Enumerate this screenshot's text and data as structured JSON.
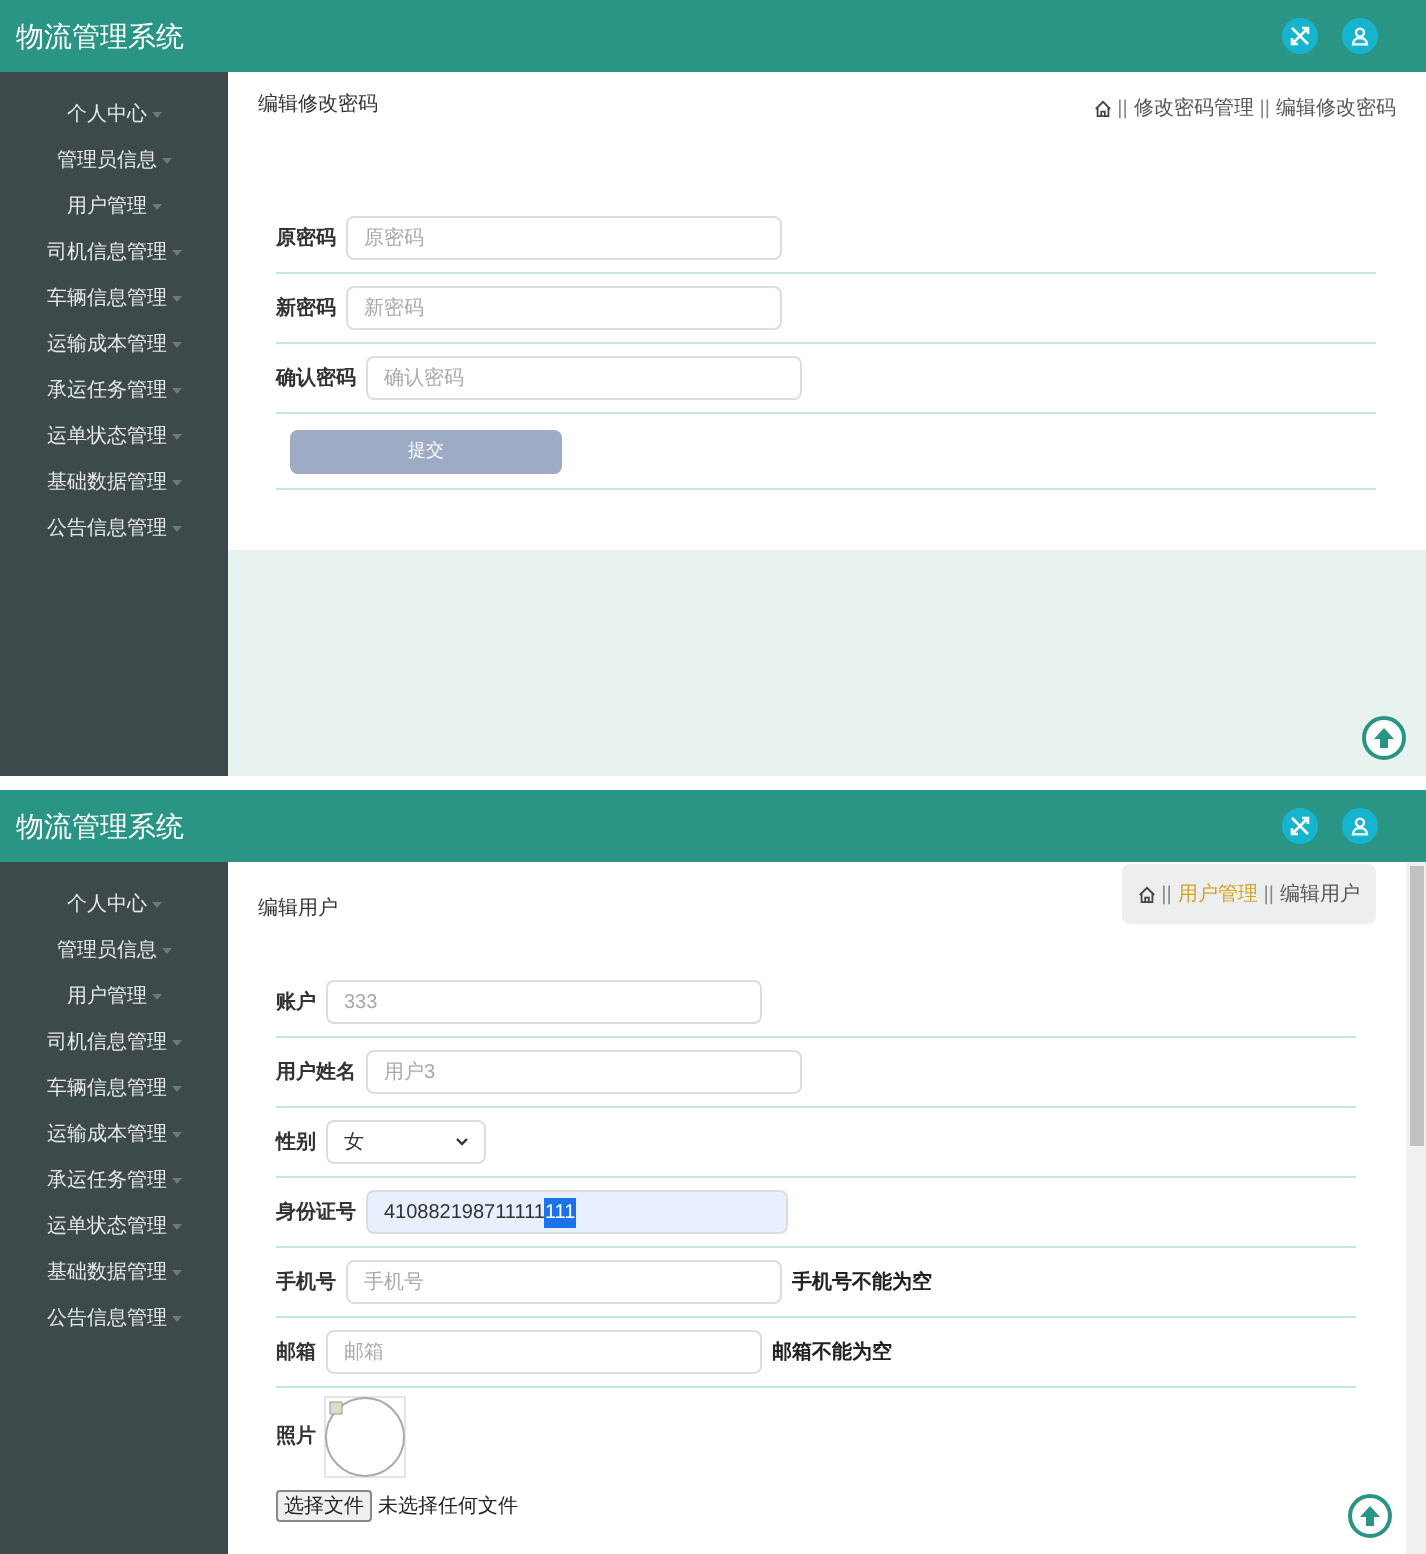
{
  "screens": [
    {
      "kind": "password",
      "header": {
        "title": "物流管理系统"
      },
      "sidebar": {
        "items": [
          "个人中心",
          "管理员信息",
          "用户管理",
          "司机信息管理",
          "车辆信息管理",
          "运输成本管理",
          "承运任务管理",
          "运单状态管理",
          "基础数据管理",
          "公告信息管理"
        ]
      },
      "page_title": "编辑修改密码",
      "breadcrumb": {
        "boxed": false,
        "separator": "||",
        "items": [
          {
            "label": "修改密码管理",
            "link": false
          },
          {
            "label": "编辑修改密码",
            "link": false
          }
        ]
      },
      "rows": [
        {
          "kind": "input",
          "label": "原密码",
          "placeholder": "原密码"
        },
        {
          "kind": "input",
          "label": "新密码",
          "placeholder": "新密码"
        },
        {
          "kind": "input",
          "label": "确认密码",
          "placeholder": "确认密码"
        }
      ],
      "submit": "提交",
      "scrollbar": false
    },
    {
      "kind": "user",
      "header": {
        "title": "物流管理系统"
      },
      "sidebar": {
        "items": [
          "个人中心",
          "管理员信息",
          "用户管理",
          "司机信息管理",
          "车辆信息管理",
          "运输成本管理",
          "承运任务管理",
          "运单状态管理",
          "基础数据管理",
          "公告信息管理"
        ]
      },
      "page_title": "编辑用户",
      "breadcrumb": {
        "boxed": true,
        "separator": "||",
        "items": [
          {
            "label": "用户管理",
            "link": true
          },
          {
            "label": "编辑用户",
            "link": false
          }
        ]
      },
      "rows": [
        {
          "kind": "input",
          "label": "账户",
          "placeholder": "333"
        },
        {
          "kind": "input",
          "label": "用户姓名",
          "placeholder": "用户3"
        },
        {
          "kind": "select",
          "label": "性别",
          "value": "女"
        },
        {
          "kind": "filled",
          "label": "身份证号",
          "value": "410882198711111",
          "selection": "111"
        },
        {
          "kind": "input",
          "label": "手机号",
          "placeholder": "手机号",
          "error": "手机号不能为空"
        },
        {
          "kind": "input",
          "label": "邮箱",
          "placeholder": "邮箱",
          "error": "邮箱不能为空"
        },
        {
          "kind": "photo",
          "label": "照片",
          "button": "选择文件",
          "status": "未选择任何文件"
        }
      ],
      "scrollbar": true
    }
  ]
}
